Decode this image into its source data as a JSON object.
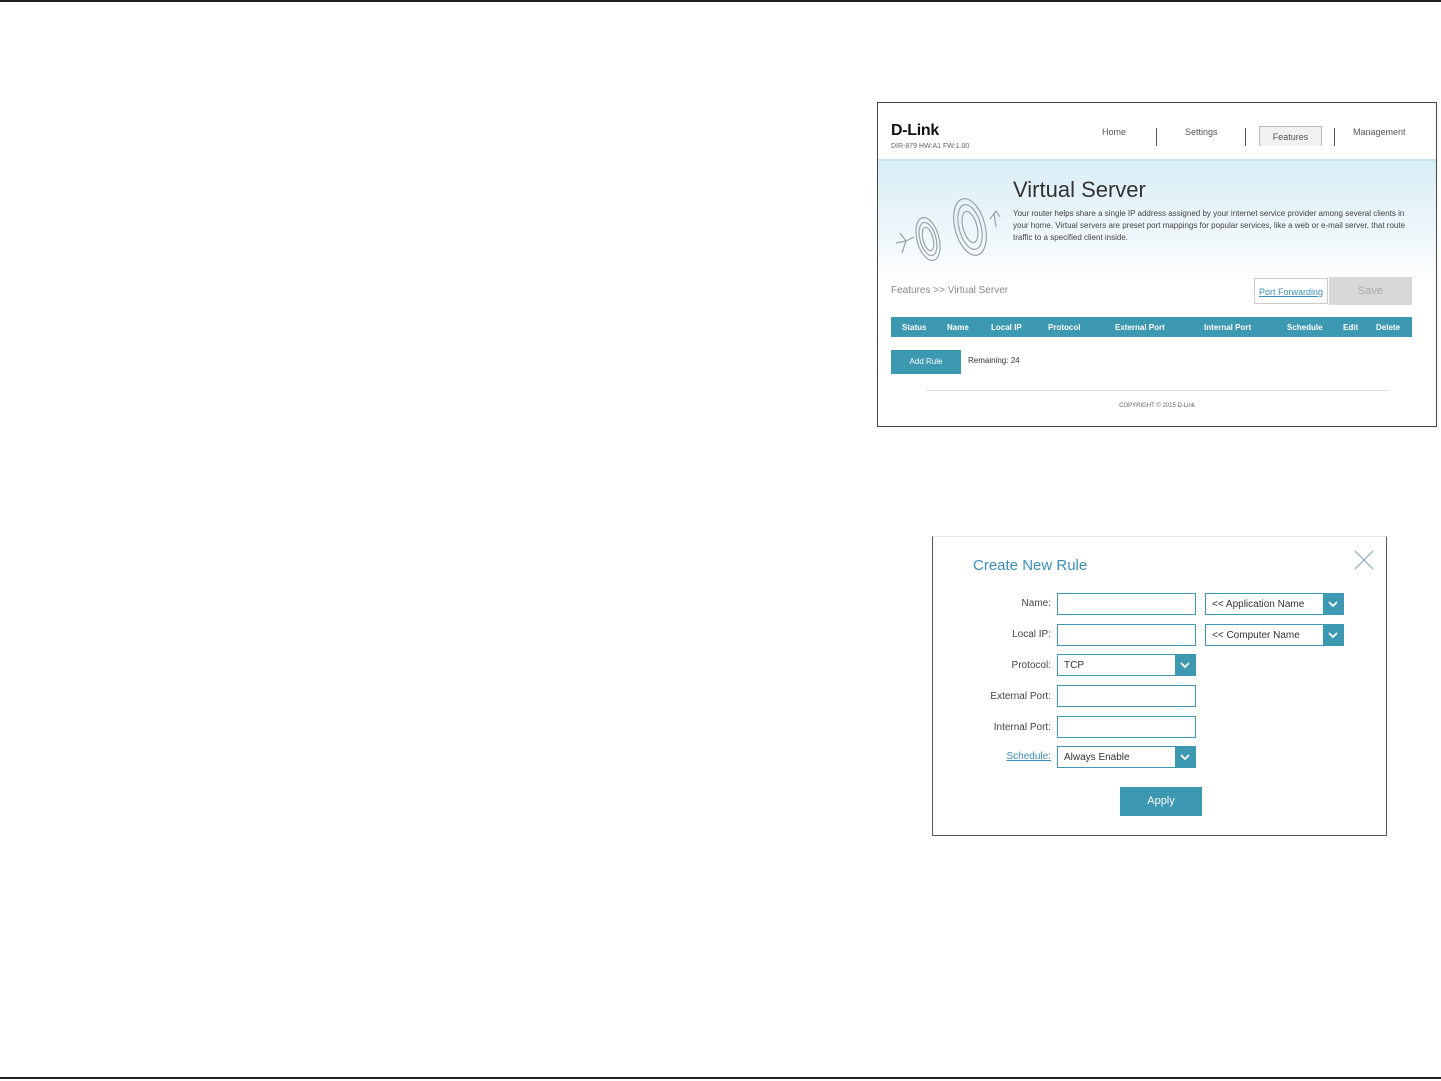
{
  "virtual_server": {
    "brand": "D-Link",
    "model": "DIR-879 HW:A1 FW:1.00",
    "nav": [
      "Home",
      "Settings",
      "Features",
      "Management"
    ],
    "active_nav": "Features",
    "title": "Virtual Server",
    "description": "Your router helps share a single IP address assigned by your internet service provider among several clients in your home. Virtual servers are preset port mappings for popular services, like a web or e-mail server, that route traffic to a specified client inside.",
    "breadcrumb": "Features >> Virtual Server",
    "port_forwarding_link": "Port Forwarding",
    "save_label": "Save",
    "columns": [
      "Status",
      "Name",
      "Local IP",
      "Protocol",
      "External Port",
      "Internal Port",
      "Schedule",
      "Edit",
      "Delete"
    ],
    "add_rule_label": "Add Rule",
    "remaining": "Remaining: 24",
    "copyright": "COPYRIGHT © 2015 D-Link"
  },
  "create_rule": {
    "title": "Create New Rule",
    "labels": {
      "name": "Name:",
      "local_ip": "Local IP:",
      "protocol": "Protocol:",
      "external_port": "External Port:",
      "internal_port": "Internal Port:",
      "schedule": "Schedule:"
    },
    "values": {
      "name": "",
      "local_ip": "",
      "external_port": "",
      "internal_port": ""
    },
    "application_select": "<< Application Name",
    "computer_select": "<< Computer Name",
    "protocol_value": "TCP",
    "schedule_value": "Always Enable",
    "apply_label": "Apply"
  },
  "colors": {
    "accent": "#3d98b2",
    "link": "#3a8fb7"
  }
}
